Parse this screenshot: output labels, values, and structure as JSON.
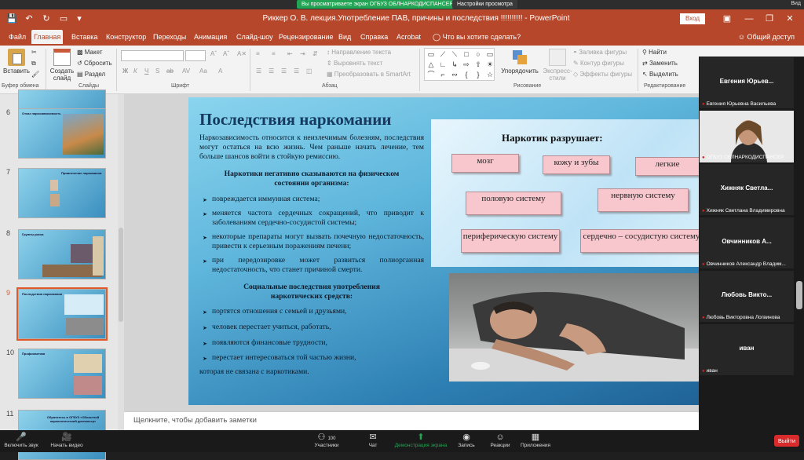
{
  "zoom_banner": {
    "sharing_text": "Вы просматриваете экран ОГБУЗ ОБЛНАРКОДИСПАНСЕР",
    "view_options": "Настройки просмотра",
    "viewer_label": "Вид"
  },
  "titlebar": {
    "title": "Риккер О. В. лекция.Употребление ПАВ, причины и последствия  !!!!!!!!!!  -  PowerPoint",
    "login": "Вход"
  },
  "tabs": [
    {
      "label": "Файл"
    },
    {
      "label": "Главная"
    },
    {
      "label": "Вставка"
    },
    {
      "label": "Конструктор"
    },
    {
      "label": "Переходы"
    },
    {
      "label": "Анимация"
    },
    {
      "label": "Слайд-шоу"
    },
    {
      "label": "Рецензирование"
    },
    {
      "label": "Вид"
    },
    {
      "label": "Справка"
    },
    {
      "label": "Acrobat"
    },
    {
      "label": "Что вы хотите сделать?"
    }
  ],
  "share_label": "Общий доступ",
  "ribbon": {
    "paste": "Вставить",
    "new_slide": "Создать слайд",
    "layout": "Макет",
    "reset": "Сбросить",
    "section": "Раздел",
    "text_direction": "Направление текста",
    "align_text": "Выровнять текст",
    "smartart": "Преобразовать в SmartArt",
    "arrange": "Упорядочить",
    "quick_styles": "Экспресс-стили",
    "shape_fill": "Заливка фигуры",
    "shape_outline": "Контур фигуры",
    "shape_effects": "Эффекты фигуры",
    "find": "Найти",
    "replace": "Заменить",
    "select": "Выделить",
    "groups": {
      "clipboard": "Буфер обмена",
      "slides": "Слайды",
      "font": "Шрифт",
      "paragraph": "Абзац",
      "drawing": "Рисование",
      "editing": "Редактирование"
    },
    "format_buttons": [
      "Ж",
      "К",
      "Ч",
      "S",
      "ab",
      "AV",
      "Aa"
    ]
  },
  "thumbnails": [
    {
      "num": "6",
      "title": "Отказ наркозависимость"
    },
    {
      "num": "7",
      "title": "Привлечение наркоманов"
    },
    {
      "num": "8",
      "title": "Группы риска"
    },
    {
      "num": "9",
      "title": "Последствия наркомании"
    },
    {
      "num": "10",
      "title": "Профилактика"
    },
    {
      "num": "11",
      "title": "Обратитесь в ОГБУЗ «Областной наркологический диспансер»"
    }
  ],
  "slide": {
    "title": "Последствия наркомании",
    "intro": "Наркозависимость относится к неизлечимым болезням, последствия могут остаться на всю жизнь. Чем раньше начать лечение, тем больше шансов войти в стойкую ремиссию.",
    "physical_heading": "Наркотики негативно сказываются на физическом состоянии организма:",
    "physical_items": [
      "повреждается иммунная система;",
      "меняется частота сердечных сокращений, что приводит к заболеваниям сердечно-сосудистой системы;",
      "некоторые препараты могут вызвать почечную недостаточность, привести к серьезным поражениям печени;",
      "при передозировке может развиться полиорганная недостаточность, что станет причиной смерти."
    ],
    "social_heading": "Социальные последствия употребления наркотических средств:",
    "social_items": [
      "портятся отношения с семьей и друзьями,",
      "человек перестает учиться, работать,",
      "появляются финансовые трудности,",
      "перестает интересоваться той частью жизни,"
    ],
    "social_tail": "которая не связана с наркотиками.",
    "drug_heading": "Наркотик разрушает:",
    "organs": [
      "мозг",
      "кожу и зубы",
      "легкие",
      "половую систему",
      "нервную систему",
      "периферическую систему",
      "сердечно – сосудистую систему"
    ]
  },
  "notes_placeholder": "Щелкните, чтобы добавить заметки",
  "participants": [
    {
      "name": "Евгения  Юрьев...",
      "sub": "Евгения Юрьевна Васильева",
      "video": false
    },
    {
      "name": "",
      "sub": "ОГБУЗ ОБЛНАРКОДИСПАНСЕР",
      "video": true
    },
    {
      "name": "Хижняк  Светла...",
      "sub": "Хижняк Светлана Владимировна",
      "video": false
    },
    {
      "name": "Овчинников  А...",
      "sub": "Овчинников Александр Владим...",
      "video": false
    },
    {
      "name": "Любовь  Викто...",
      "sub": "Любовь Викторовна Логвинова",
      "video": false
    },
    {
      "name": "иван",
      "sub": "иван",
      "video": false
    }
  ],
  "zoombar": {
    "audio": "Включить звук",
    "video": "Начать видео",
    "participants": "Участники",
    "participants_count": "100",
    "chat": "Чат",
    "share": "Демонстрация экрана",
    "record": "Запись",
    "reactions": "Реакции",
    "apps": "Приложения",
    "leave": "Выйти"
  }
}
